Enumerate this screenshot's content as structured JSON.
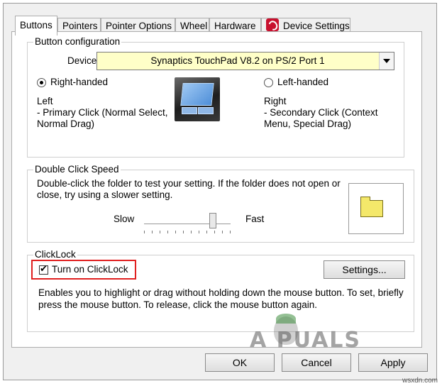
{
  "tabs": [
    "Buttons",
    "Pointers",
    "Pointer Options",
    "Wheel",
    "Hardware",
    "Device Settings"
  ],
  "button_config": {
    "legend": "Button configuration",
    "devices_label": "Devices:",
    "device_selected": "Synaptics TouchPad V8.2 on PS/2 Port 1",
    "right_handed": "Right-handed",
    "left_handed": "Left-handed",
    "right_handed_selected": true,
    "left_title": "Left",
    "left_desc_1": " - Primary Click (Normal Select,",
    "left_desc_2": "Normal Drag)",
    "right_title": "Right",
    "right_desc_1": " - Secondary Click (Context",
    "right_desc_2": "Menu, Special Drag)"
  },
  "double_click": {
    "legend": "Double Click Speed",
    "desc_1": "Double-click the folder to test your setting.  If the folder does not open or",
    "desc_2": "close, try using a slower setting.",
    "slow": "Slow",
    "fast": "Fast",
    "speed_fraction": 0.8
  },
  "clicklock": {
    "legend": "ClickLock",
    "checkbox_label": "Turn on ClickLock",
    "checked": true,
    "settings_button": "Settings...",
    "desc_1": "Enables you to highlight or drag without holding down the mouse button.  To set, briefly",
    "desc_2": "press the mouse button.  To release, click the mouse button again."
  },
  "footer": {
    "ok": "OK",
    "cancel": "Cancel",
    "apply": "Apply"
  },
  "watermark": {
    "brand": "A  PUALS",
    "site": "wsxdn.com"
  },
  "colors": {
    "highlight": "#e02020",
    "device_bg": "#ffffc8",
    "device_settings_icon": "#c8102e"
  }
}
